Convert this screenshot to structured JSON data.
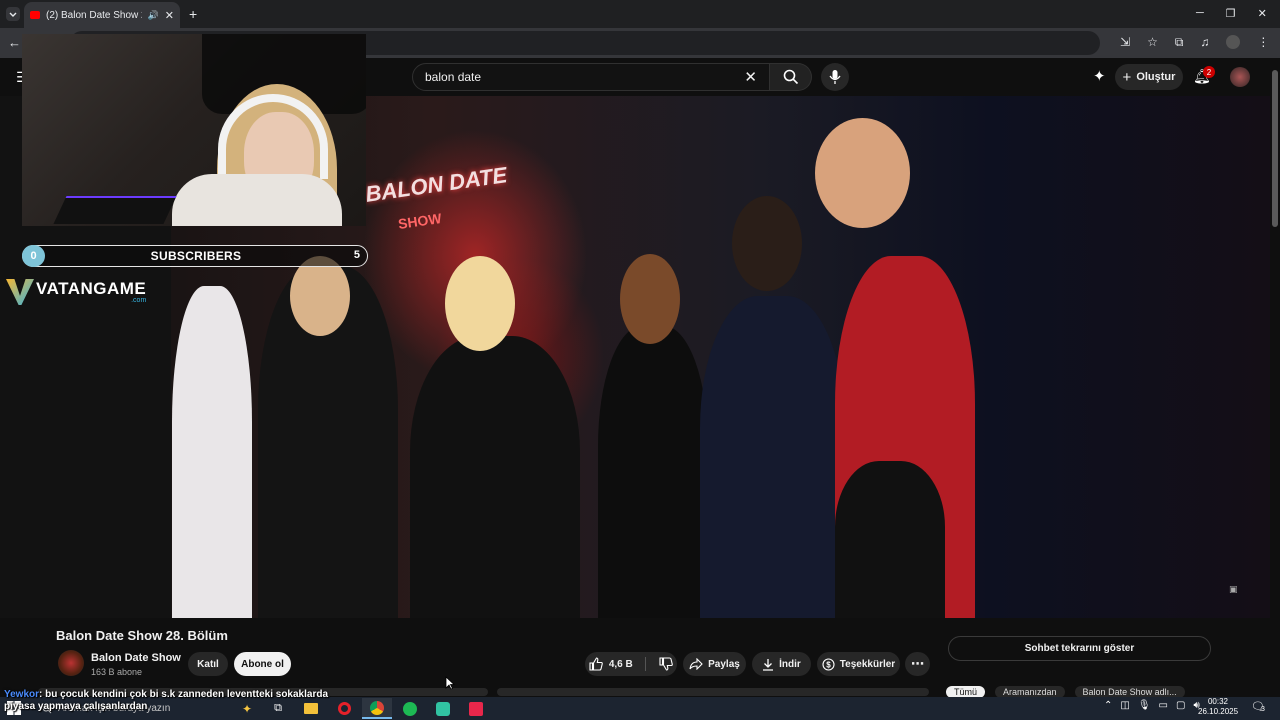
{
  "browser": {
    "tab_title": "(2) Balon Date Show 28. Bölü",
    "new_tab_label": "+"
  },
  "masthead": {
    "search_value": "balon date",
    "create_label": "Oluştur",
    "notification_count": "2"
  },
  "overlay": {
    "subs_current": "0",
    "subs_label": "SUBSCRIBERS",
    "subs_goal": "5",
    "logo_text": "VATANGAME",
    "logo_sub": ".com",
    "sign_line1": "BALON DATE",
    "sign_line2": "SHOW"
  },
  "video": {
    "title": "Balon Date Show 28. Bölüm",
    "channel_name": "Balon Date Show",
    "channel_subs": "163 B abone",
    "join_label": "Katıl",
    "subscribe_label": "Abone ol",
    "likes": "4,6 B",
    "share_label": "Paylaş",
    "download_label": "İndir",
    "thanks_label": "Teşekkürler",
    "chat_replay_label": "Sohbet tekrarını göster",
    "chips": [
      "Tümü",
      "Aramanızdan",
      "Balon Date Show adlı..."
    ]
  },
  "stream_chat": {
    "user": "Yewkor",
    "message": ": bu çocuk kendini çok bi s.k zanneden leventteki sokaklarda piyasa yapmaya çalışanlardan"
  },
  "taskbar": {
    "search_placeholder": "Aramak için buraya yazın",
    "time": "00:32",
    "date": "26.10.2025",
    "notification_count": "3"
  },
  "colors": {
    "yt_bg": "#0f0f0f",
    "accent_red": "#ff0000",
    "chat_user": "#4a8cff"
  }
}
